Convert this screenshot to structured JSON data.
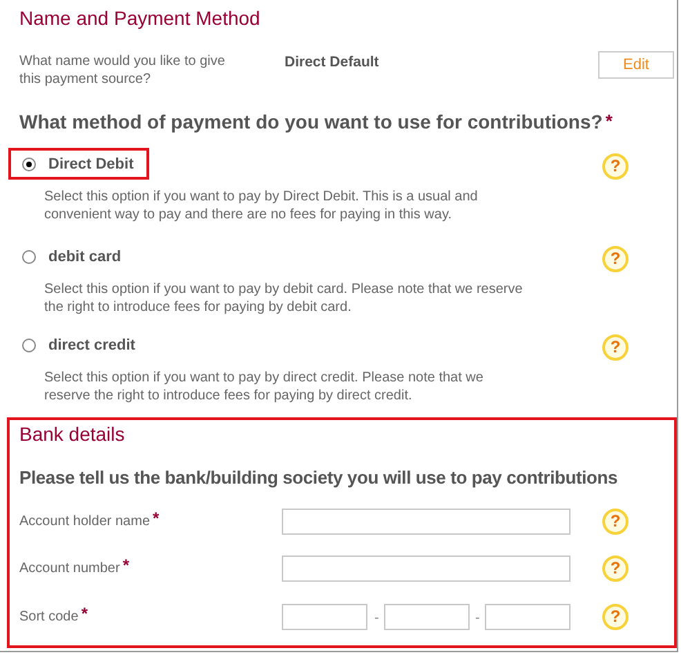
{
  "section_title": "Name and Payment Method",
  "name_field": {
    "label": "What name would you like to give this payment source?",
    "value": "Direct Default",
    "button": "Edit"
  },
  "method_question": {
    "text": "What method of payment do you want to use for contributions?",
    "required_mark": "*"
  },
  "options": [
    {
      "label": "Direct Debit",
      "selected": true,
      "highlighted": true,
      "description": "Select this option if you want to pay by Direct Debit. This is a usual and convenient way to pay and there are no fees for paying in this way.",
      "help": "?"
    },
    {
      "label": "debit card",
      "selected": false,
      "highlighted": false,
      "description": "Select this option if you want to pay by debit card. Please note that we reserve the right to introduce fees for paying by debit card.",
      "help": "?"
    },
    {
      "label": "direct credit",
      "selected": false,
      "highlighted": false,
      "description": "Select this option if you want to pay by direct credit. Please note that we reserve the right to introduce fees for paying by direct credit.",
      "help": "?"
    }
  ],
  "bank_details": {
    "title": "Bank details",
    "highlighted": true,
    "heading": "Please tell us the bank/building society you will use to pay contributions",
    "fields": [
      {
        "kind": "single",
        "label": "Account holder name",
        "required_mark": "*",
        "help": "?"
      },
      {
        "kind": "single",
        "label": "Account number",
        "required_mark": "*",
        "help": "?"
      },
      {
        "kind": "sort_code",
        "label": "Sort code",
        "required_mark": "*",
        "separators": [
          "-",
          "-"
        ],
        "help": "?"
      }
    ]
  }
}
